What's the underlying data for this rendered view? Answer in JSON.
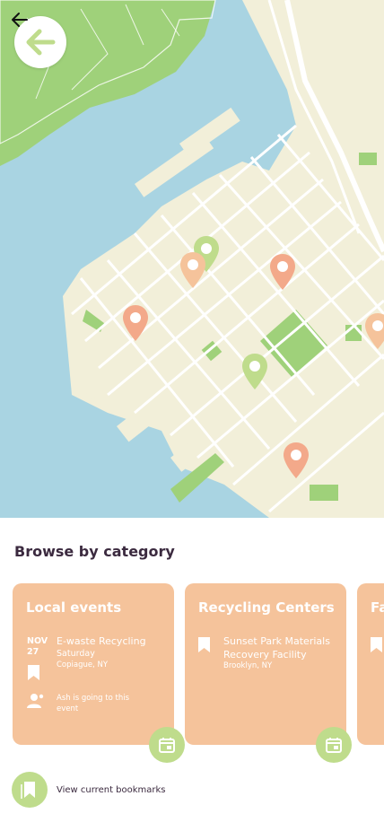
{
  "map": {
    "colors": {
      "water": "#a9d4e2",
      "land": "#f2efd9",
      "park": "#9fd17a",
      "road": "#ffffff"
    },
    "pins": [
      {
        "color": "#bfdc8c"
      },
      {
        "color": "#f5c39b"
      },
      {
        "color": "#f3a98a"
      },
      {
        "color": "#f3a98a"
      },
      {
        "color": "#bfdc8c"
      },
      {
        "color": "#f5c39b"
      },
      {
        "color": "#f3a98a"
      }
    ]
  },
  "nav": {
    "back_icon": "arrow-left-icon",
    "back_circle_icon": "arrow-left-icon"
  },
  "browse": {
    "title": "Browse by category",
    "cards": [
      {
        "title": "Local events",
        "date_month": "NOV",
        "date_day": "27",
        "event_title": "E-waste Recycling",
        "event_day": "Saturday",
        "event_location": "Copiague, NY",
        "attendee_note": "Ash is going to this event",
        "icon": "calendar-icon"
      },
      {
        "title": "Recycling Centers",
        "center_name": "Sunset Park Materials Recovery Facility",
        "center_location": "Brooklyn, NY",
        "icon": "calendar-icon"
      },
      {
        "title": "Fa"
      }
    ]
  },
  "bookmarks": {
    "label": "View current bookmarks",
    "icon": "bookmark-icon"
  },
  "colors": {
    "accent_green": "#bfdc8c",
    "card_peach": "#f5c39b",
    "text_dark": "#3b2a3f"
  }
}
